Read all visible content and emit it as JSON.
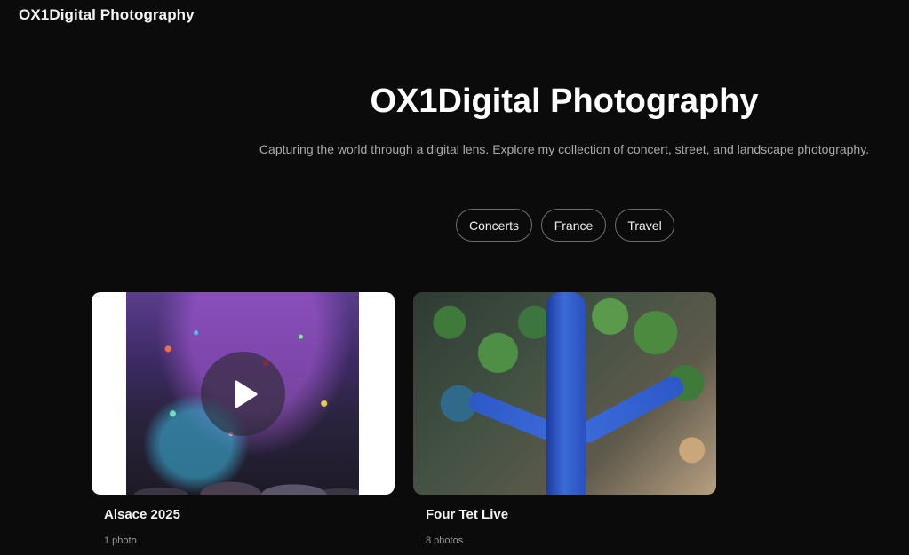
{
  "header": {
    "brand": "OX1Digital Photography"
  },
  "hero": {
    "title": "OX1Digital Photography",
    "subtitle": "Capturing the world through a digital lens. Explore my collection of concert, street, and landscape photography."
  },
  "tags": [
    {
      "label": "Concerts"
    },
    {
      "label": "France"
    },
    {
      "label": "Travel"
    }
  ],
  "albums": [
    {
      "title": "Alsace 2025",
      "count": "1 photo",
      "media": "video",
      "icon": "play-icon"
    },
    {
      "title": "Four Tet Live",
      "count": "8 photos",
      "media": "image"
    }
  ],
  "colors": {
    "background": "#0b0b0c",
    "text": "#ffffff",
    "muted": "#a9a9a9",
    "tag_border": "#6e6e6e"
  }
}
